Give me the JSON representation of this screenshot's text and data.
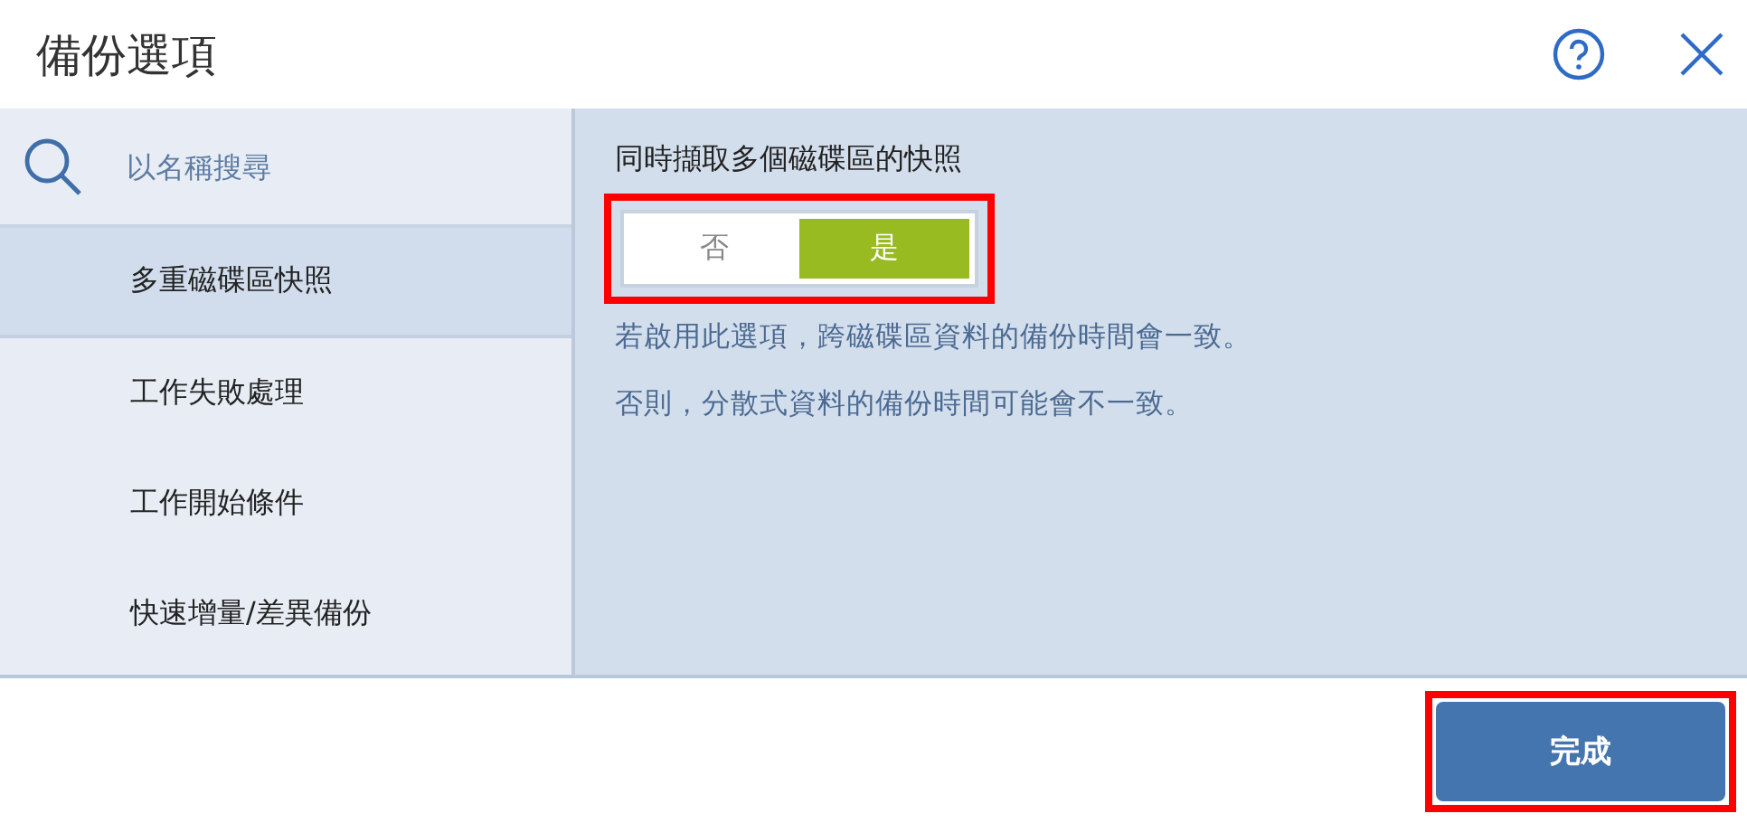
{
  "window": {
    "title": "備份選項"
  },
  "sidebar": {
    "search": {
      "placeholder": "以名稱搜尋"
    },
    "items": [
      {
        "label": "多重磁碟區快照",
        "selected": true
      },
      {
        "label": "工作失敗處理",
        "selected": false
      },
      {
        "label": "工作開始條件",
        "selected": false
      },
      {
        "label": "快速增量/差異備份",
        "selected": false
      }
    ]
  },
  "setting": {
    "title": "同時擷取多個磁碟區的快照",
    "highlighted": true,
    "options": [
      {
        "label": "否",
        "selected": false
      },
      {
        "label": "是",
        "selected": true
      }
    ],
    "notes": [
      "若啟用此選項，跨磁碟區資料的備份時間會一致。",
      "否則，分散式資料的備份時間可能會不一致。"
    ]
  },
  "done_button": {
    "label": "完成",
    "highlighted": true
  }
}
